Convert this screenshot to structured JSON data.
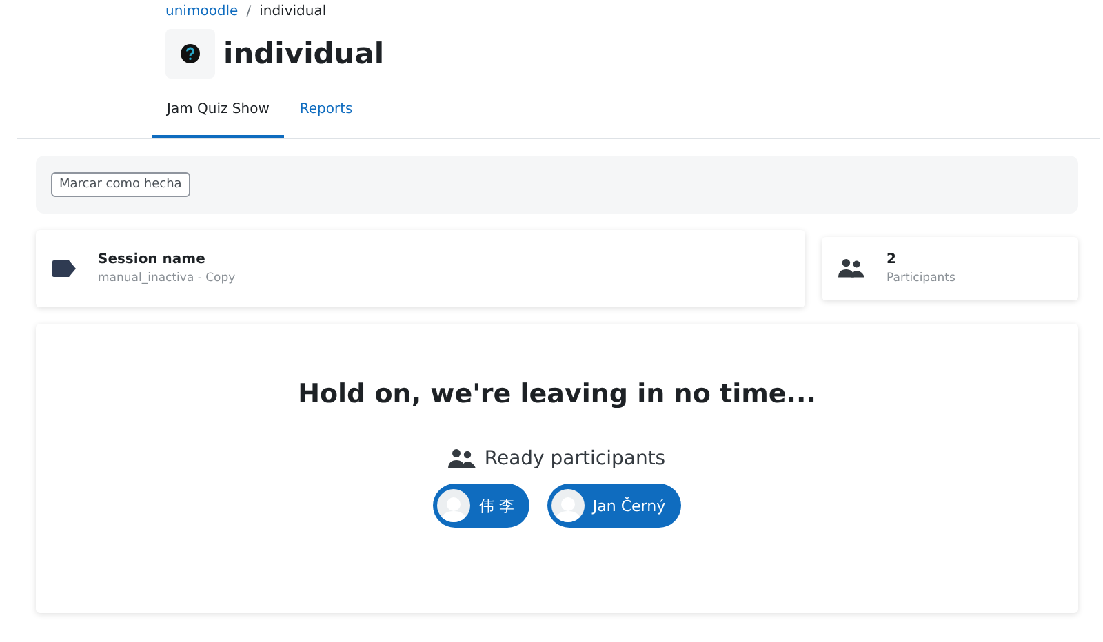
{
  "breadcrumb": [
    {
      "label": "unimoodle",
      "kind": "link"
    },
    {
      "label": "individual",
      "kind": "current"
    }
  ],
  "breadcrumb_separator": "/",
  "title": "individual",
  "tabs": [
    {
      "label": "Jam Quiz Show",
      "selected": true
    },
    {
      "label": "Reports",
      "selected": false
    }
  ],
  "completion_button": "Marcar como hecha",
  "session": {
    "label": "Session name",
    "value": "manual_inactiva - Copy"
  },
  "participants_card": {
    "count": "2",
    "label": "Participants"
  },
  "waiting": {
    "heading": "Hold on, we're leaving in no time...",
    "subheading": "Ready participants",
    "participants": [
      {
        "name": "伟 李"
      },
      {
        "name": "Jan Černý"
      }
    ]
  }
}
